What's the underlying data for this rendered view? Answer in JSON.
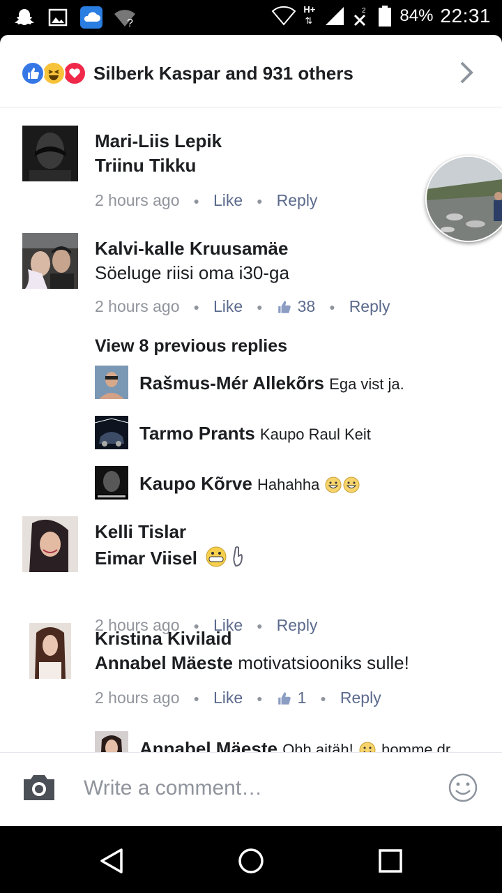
{
  "status_bar": {
    "battery": "84%",
    "time": "22:31",
    "network": "H+",
    "sim1": "1",
    "sim2": "2"
  },
  "reactions": {
    "summary": "Silberk Kaspar and 931 others"
  },
  "comments": [
    {
      "name": "Mari-Liis Lepik",
      "text": "Triinu Tikku",
      "time": "2 hours ago",
      "like": "Like",
      "reply": "Reply"
    },
    {
      "name": "Kalvi-kalle Kruusamäe",
      "text": "Söeluge riisi oma i30-ga",
      "time": "2 hours ago",
      "like": "Like",
      "likes_count": "38",
      "reply": "Reply"
    },
    {
      "name": "Kelli Tislar",
      "text": "Eimar Viisel",
      "time": "2 hours ago",
      "like": "Like",
      "reply": "Reply"
    },
    {
      "name": "Kristina Kivilaid",
      "mention": "Annabel Mäeste",
      "text": "motivatsiooniks sulle!",
      "time": "2 hours ago",
      "like": "Like",
      "likes_count": "1",
      "reply": "Reply"
    }
  ],
  "view_previous_replies": "View 8 previous replies",
  "replies": [
    {
      "name": "Rašmus-Mér Allekõrs",
      "text": "Ega vist ja."
    },
    {
      "name": "Tarmo Prants",
      "text": "Kaupo Raul Keit"
    },
    {
      "name": "Kaupo Kõrve",
      "text": "Hahahha"
    },
    {
      "name": "Annabel Mäeste",
      "text": "Ohh aitäh!",
      "tail": "homme dr..."
    }
  ],
  "composer": {
    "placeholder": "Write a comment…"
  }
}
